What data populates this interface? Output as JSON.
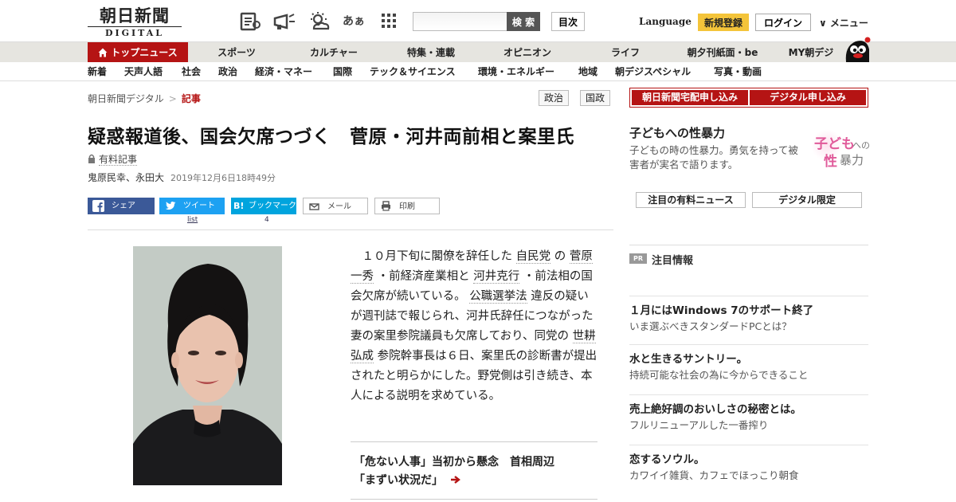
{
  "header": {
    "logo_kanji": "朝日新聞",
    "logo_sub": "DIGITAL",
    "search_button": "検 索",
    "index_button": "目次",
    "language": "Language",
    "signup": "新規登録",
    "login": "ログイン",
    "menu": "∨ メニュー",
    "icons": [
      "newspaper-icon",
      "megaphone-icon",
      "weather-icon",
      "font-size-icon",
      "grid-menu-icon"
    ],
    "font_size_glyph": "あぁ"
  },
  "nav_primary": [
    "トップニュース",
    "スポーツ",
    "カルチャー",
    "特集・連載",
    "オピニオン",
    "ライフ",
    "朝夕刊紙面・be",
    "MY朝デジ"
  ],
  "nav_secondary": [
    "新着",
    "天声人語",
    "社会",
    "政治",
    "経済・マネー",
    "国際",
    "テック＆サイエンス",
    "環境・エネルギー",
    "地域",
    "朝デジスペシャル",
    "写真・動画"
  ],
  "breadcrumb": {
    "home": "朝日新聞デジタル",
    "sep": ">",
    "current": "記事"
  },
  "tags": [
    "政治",
    "国政"
  ],
  "article": {
    "headline": "疑惑報道後、国会欠席つづく　菅原・河井両前相と案里氏",
    "paid_label": "有料記事",
    "authors": "鬼原民幸、永田大",
    "date": "2019年12月6日18時49分",
    "share": {
      "facebook": "シェア",
      "twitter": "ツイート",
      "twitter_count": "list",
      "hatena": "ブックマーク",
      "hatena_count": "4",
      "mail": "メール",
      "print": "印刷"
    },
    "body_parts": [
      {
        "t": "　１０月下旬に閣僚を辞任した ",
        "link": false
      },
      {
        "t": "自民党",
        "link": true
      },
      {
        "t": " の ",
        "link": false
      },
      {
        "t": "菅原一秀",
        "link": true
      },
      {
        "t": " ・前経済産業相と ",
        "link": false
      },
      {
        "t": "河井克行",
        "link": true
      },
      {
        "t": " ・前法相の国会欠席が続いている。 ",
        "link": false
      },
      {
        "t": "公職選挙法",
        "link": true
      },
      {
        "t": " 違反の疑いが週刊誌で報じられ、河井氏辞任につながった妻の案里参院議員も欠席しており、同党の ",
        "link": false
      },
      {
        "t": "世耕弘成",
        "link": true
      },
      {
        "t": " 参院幹事長は６日、案里氏の診断書が提出されたと明らかにした。野党側は引き続き、本人による説明を求めている。",
        "link": false
      }
    ],
    "related_line1": "「危ない人事」当初から懸念　首相周辺",
    "related_line2": "「まずい状況だ」"
  },
  "sidebar": {
    "subscribe_paper": "朝日新聞宅配申し込み",
    "subscribe_digital": "デジタル申し込み",
    "promo_title": "子どもへの性暴力",
    "promo_text": "子どもの時の性暴力。勇気を持って被害者が実名で語ります。",
    "promo_logo_1": "子ども",
    "promo_logo_2": "への",
    "promo_logo_3": "性",
    "promo_logo_4": "暴力",
    "btn_paid_news": "注目の有料ニュース",
    "btn_digital_only": "デジタル限定",
    "pr_badge": "PR",
    "pr_heading": "注目情報",
    "pr_items": [
      {
        "title": "１月にはWindows 7のサポート終了",
        "desc": "いま選ぶべきスタンダードPCとは？"
      },
      {
        "title": "水と生きるサントリー。",
        "desc": "持続可能な社会の為に今からできること"
      },
      {
        "title": "売上絶好調のおいしさの秘密とは。",
        "desc": "フルリニューアルした一番搾り"
      },
      {
        "title": "恋するソウル。",
        "desc": "カワイイ雑貨、カフェでほっこり朝食"
      }
    ]
  },
  "colors": {
    "brand_red": "#b51414",
    "signup_yellow": "#f4c43a",
    "facebook": "#3b5998",
    "twitter": "#1da1f2",
    "hatena": "#00a4de"
  }
}
